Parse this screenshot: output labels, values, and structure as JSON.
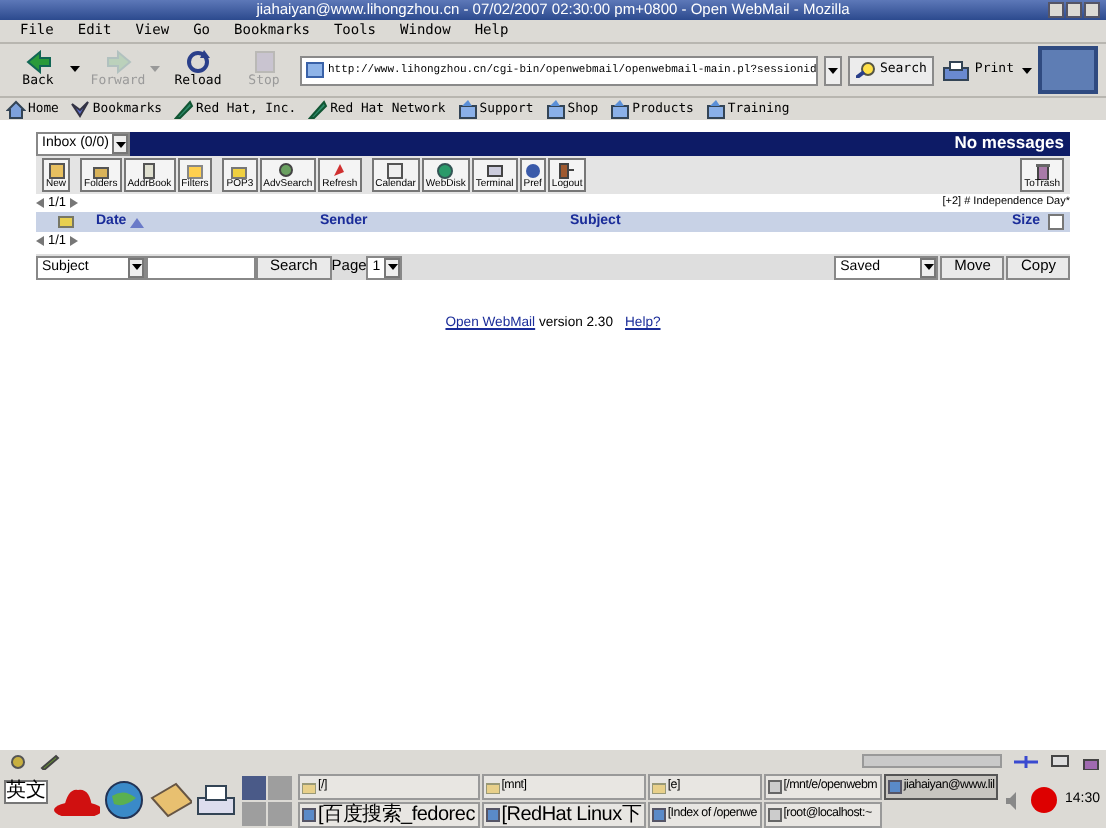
{
  "window": {
    "title": "jiahaiyan@www.lihongzhou.cn - 07/02/2007 02:30:00 pm+0800 - Open WebMail - Mozilla"
  },
  "menu": [
    "File",
    "Edit",
    "View",
    "Go",
    "Bookmarks",
    "Tools",
    "Window",
    "Help"
  ],
  "nav_toolbar": {
    "buttons": [
      {
        "kind": "back",
        "label": "Back",
        "disabled": false,
        "has_menu": true
      },
      {
        "kind": "forward",
        "label": "Forward",
        "disabled": true,
        "has_menu": true
      },
      {
        "kind": "reload",
        "label": "Reload",
        "disabled": false,
        "has_menu": false
      },
      {
        "kind": "stop",
        "label": "Stop",
        "disabled": true,
        "has_menu": false
      }
    ],
    "url": "http://www.lihongzhou.cn/cgi-bin/openwebmail/openwebmail-main.pl?sessionid",
    "search": "Search",
    "print": "Print"
  },
  "bookmarks": [
    {
      "kind": "home",
      "label": "Home"
    },
    {
      "kind": "bookmarks",
      "label": "Bookmarks"
    },
    {
      "kind": "link",
      "label": "Red Hat, Inc."
    },
    {
      "kind": "link",
      "label": "Red Hat Network"
    },
    {
      "kind": "folder",
      "label": "Support"
    },
    {
      "kind": "folder",
      "label": "Shop"
    },
    {
      "kind": "folder",
      "label": "Products"
    },
    {
      "kind": "folder",
      "label": "Training"
    }
  ],
  "mail": {
    "folder": "Inbox (0/0)",
    "status": "No messages",
    "tool_groups": [
      [
        "New"
      ],
      [
        "Folders",
        "AddrBook",
        "Filters"
      ],
      [
        "POP3",
        "AdvSearch",
        "Refresh"
      ],
      [
        "Calendar",
        "WebDisk",
        "Terminal",
        "Pref",
        "Logout"
      ]
    ],
    "to_trash": "ToTrash",
    "pager_top": "1/1",
    "event": "[+2] # Independence Day*",
    "columns": [
      {
        "label": "Date",
        "sorted": true
      },
      {
        "label": "Sender",
        "sorted": false
      },
      {
        "label": "Subject",
        "sorted": false
      },
      {
        "label": "Size",
        "sorted": false
      }
    ],
    "select_all": false,
    "pager_bottom": "1/1",
    "search_field": "Subject",
    "search_button": "Search",
    "page_label": "Page",
    "page": "1",
    "move_target": "Saved",
    "move": "Move",
    "copy": "Copy"
  },
  "footer": {
    "link": "Open WebMail",
    "version": "version 2.30",
    "help": "Help?"
  },
  "taskbar": {
    "input_method": "英文",
    "tasks": [
      {
        "label": "[/]",
        "kind": "folder",
        "selected": false
      },
      {
        "label": "[mnt]",
        "kind": "folder",
        "selected": false
      },
      {
        "label": "[e]",
        "kind": "folder",
        "selected": false
      },
      {
        "label": "[/mnt/e/openwebm",
        "kind": "terminal",
        "selected": false
      },
      {
        "label": "jiahaiyan@www.lil",
        "kind": "browser",
        "selected": true
      },
      {
        "label": "[百度搜索_fedorec",
        "kind": "browser",
        "selected": false
      },
      {
        "label": "[RedHat Linux下",
        "kind": "browser",
        "selected": false
      },
      {
        "label": "[Index of /openwe",
        "kind": "browser",
        "selected": false
      },
      {
        "label": "[root@localhost:~",
        "kind": "terminal",
        "selected": false
      }
    ],
    "clock": "14:30"
  }
}
